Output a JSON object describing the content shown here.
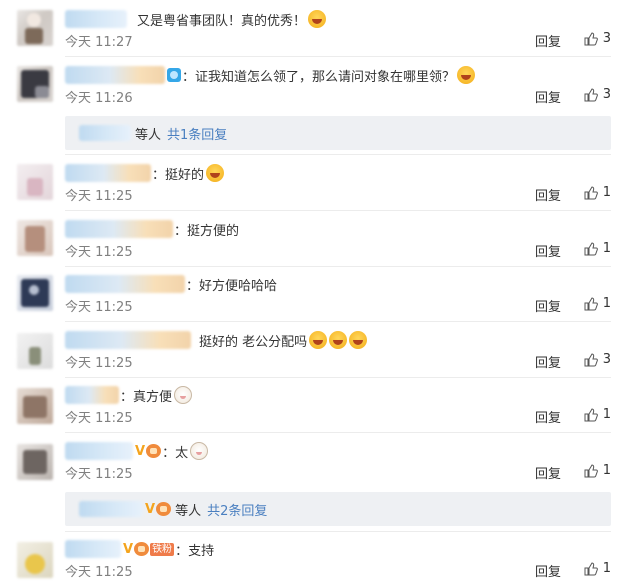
{
  "labels": {
    "reply": "回复"
  },
  "comments": [
    {
      "text": "又是粤省事团队！真的优秀！",
      "time": "今天 11:27",
      "likes": "3"
    },
    {
      "text": "证我知道怎么领了，那么请问对象在哪里领？",
      "time": "今天 11:26",
      "likes": "3"
    },
    {
      "text": "挺好的",
      "time": "今天 11:25",
      "likes": "1"
    },
    {
      "text": "挺方便的",
      "time": "今天 11:25",
      "likes": "1"
    },
    {
      "text": "好方便哈哈哈",
      "time": "今天 11:25",
      "likes": "1"
    },
    {
      "text": "挺好的 老公分配吗",
      "time": "今天 11:25",
      "likes": "3"
    },
    {
      "text": "真方便",
      "time": "今天 11:25",
      "likes": "1"
    },
    {
      "text": "太",
      "time": "今天 11:25",
      "likes": "1"
    },
    {
      "text": "支持",
      "time": "今天 11:25",
      "likes": "1"
    }
  ],
  "subreplies": [
    {
      "who": "等人",
      "link": "共1条回复"
    },
    {
      "who": "等人",
      "link": "共2条回复"
    }
  ],
  "badges": {
    "vip": "V",
    "fan": "铁粉"
  },
  "colors": {
    "link": "#4a7fc0",
    "time": "#808080",
    "subbox_bg": "#eef0f3"
  },
  "icons": {
    "like": "thumbs-up-icon",
    "emoji": "grin-emoji-icon",
    "cat": "cat-emoji-icon"
  }
}
